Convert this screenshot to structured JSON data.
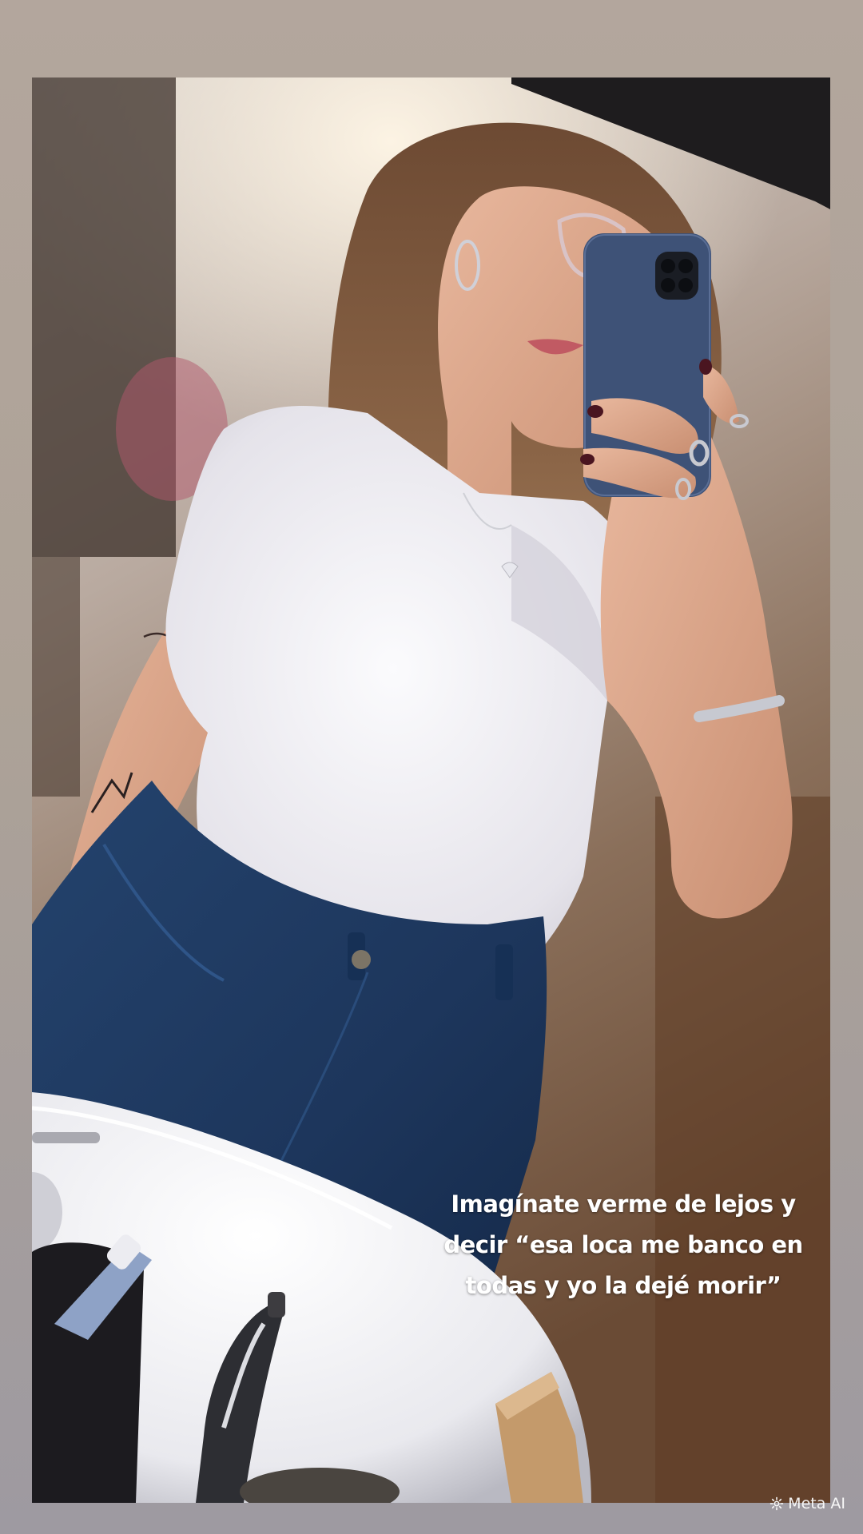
{
  "story": {
    "caption_lines": [
      "Imagínate verme de lejos y",
      "decir “esa loca me banco en",
      "todas y yo la dejé morir”"
    ]
  },
  "watermark": {
    "label": "Meta AI",
    "icon": "sparkle-icon"
  },
  "colors": {
    "frame_background": "#b3a69d",
    "shirt": "#efeef2",
    "jeans": "#1f3a63",
    "phone_case": "#3e5277",
    "sink": "#f4f4f6",
    "caption_text": "#ffffff"
  }
}
